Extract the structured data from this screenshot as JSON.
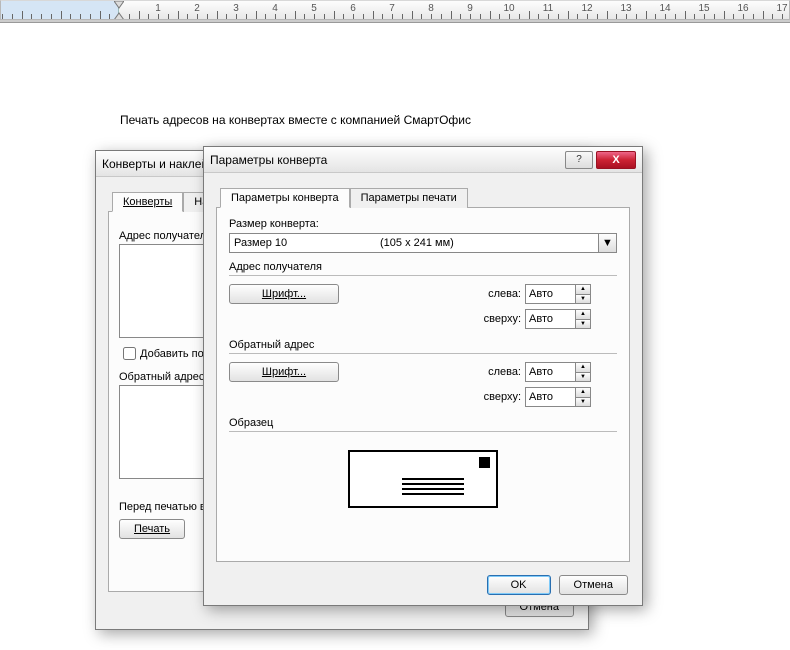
{
  "document": {
    "heading": "Печать адресов на конвертах вместе с компанией СмартОфис"
  },
  "underDialog": {
    "title": "Конверты и наклейки",
    "tabs": {
      "tab1": "Конверты",
      "tab2": "Наклейки"
    },
    "recipientLabel": "Адрес получателя:",
    "addPostal": "Добавить почтовый штрих-код",
    "returnLabel": "Обратный адрес:",
    "beforePrint": "Перед печатью вставьте конверты в следующий лоток принтера...",
    "printBtn": "Печать",
    "cancelBtn": "Отмена"
  },
  "topDialog": {
    "title": "Параметры конверта",
    "help": "?",
    "close": "X",
    "tabs": {
      "tab1": "Параметры конверта",
      "tab2": "Параметры печати"
    },
    "sizeLabel": "Размер конверта:",
    "sizeValue": "Размер 10",
    "sizeDim": "(105 x 241 мм)",
    "recipGroup": "Адрес получателя",
    "returnGroup": "Обратный адрес",
    "fontBtn": "Шрифт...",
    "leftLabel": "слева:",
    "topLabel": "сверху:",
    "autoValue": "Авто",
    "previewLabel": "Образец",
    "okBtn": "OK",
    "cancelBtn": "Отмена"
  },
  "ruler": {
    "unitsMax": 17
  }
}
